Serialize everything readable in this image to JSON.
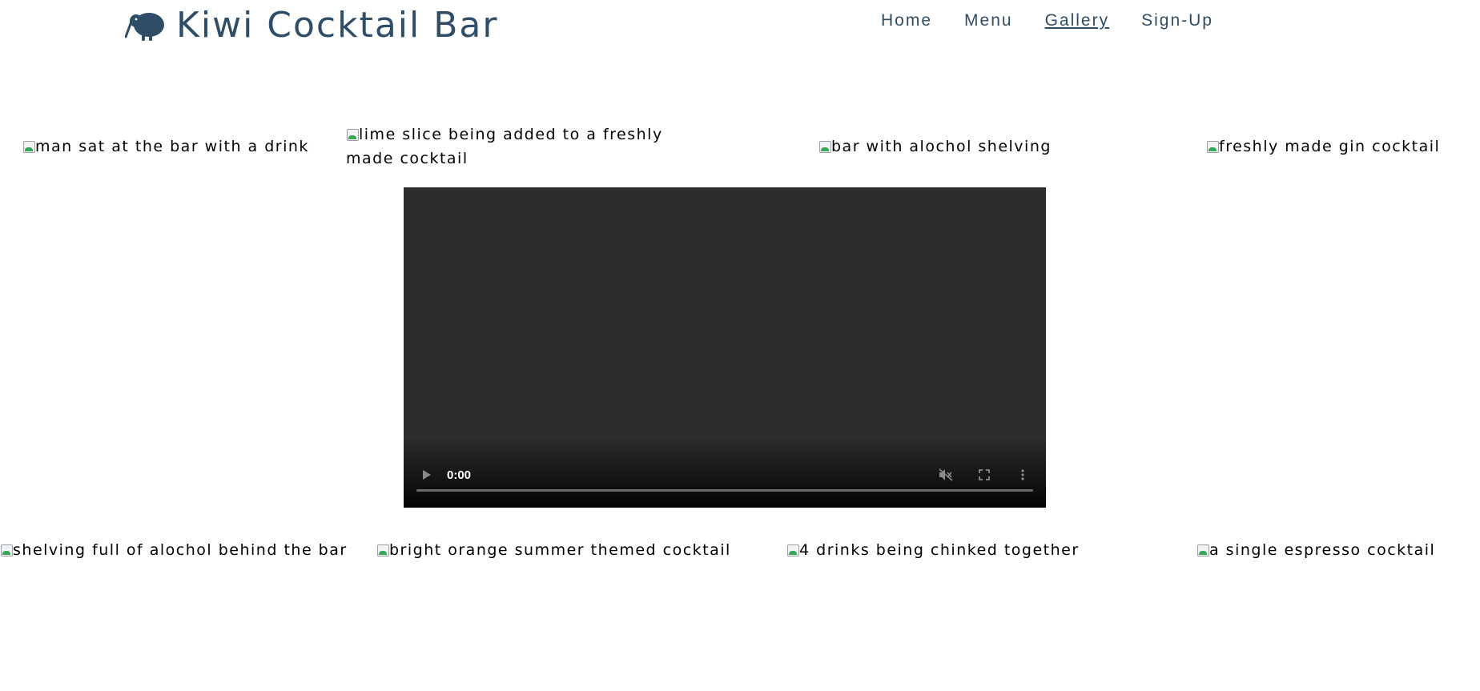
{
  "header": {
    "brand": "Kiwi Cocktail Bar",
    "brand_icon": "kiwi-bird-icon",
    "brand_color": "#2f4d66",
    "nav": [
      {
        "label": "Home",
        "active": false
      },
      {
        "label": "Menu",
        "active": false
      },
      {
        "label": "Gallery",
        "active": true
      },
      {
        "label": "Sign-Up",
        "active": false
      }
    ]
  },
  "gallery": {
    "top_row": [
      "man sat at the bar with a drink",
      "lime slice being added to a freshly made cocktail",
      "bar with alochol shelving",
      "freshly made gin cocktail"
    ],
    "bottom_row": [
      "shelving full of alochol behind the bar",
      "bright orange summer themed cocktail",
      "4 drinks being chinked together",
      "a single espresso cocktail"
    ]
  },
  "video": {
    "time": "0:00",
    "background": "#2d2d2d",
    "icons": [
      "play-icon",
      "mute-icon",
      "fullscreen-icon",
      "more-options-icon"
    ]
  }
}
